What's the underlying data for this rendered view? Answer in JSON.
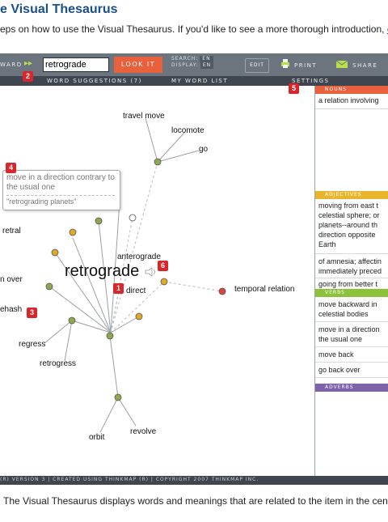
{
  "page": {
    "heading": "e Visual Thesaurus",
    "intro": "eps on how to use the Visual Thesaurus. If you'd like to see a more thorough introduction, ",
    "intro_link": "click",
    "caption": "The Visual Thesaurus displays words and meanings that are related to the item in the center"
  },
  "toolbar": {
    "forward_label": "WARD",
    "search_value": "retrograde",
    "lookup_label": "LOOK IT UP",
    "search_label": "SEARCH:",
    "search_lang": "EN",
    "display_label": "DISPLAY:",
    "display_lang": "EN",
    "edit_label": "EDIT",
    "print_label": "PRINT",
    "share_label": "SHARE"
  },
  "subbar": {
    "word_suggestions": "WORD SUGGESTIONS (7)",
    "word_list": "MY WORD LIST",
    "settings": "SETTINGS"
  },
  "badges": {
    "b1": "1",
    "b2": "2",
    "b3": "3",
    "b4": "4",
    "b5": "5",
    "b6": "6"
  },
  "graph": {
    "center": "retrograde",
    "words": {
      "travel_move": "travel move",
      "locomote": "locomote",
      "go": "go",
      "retral": "retral",
      "anterograde": "anterograde",
      "direct": "direct",
      "temporal_relation": "temporal relation",
      "go_back_over": "n over",
      "rehash": "ehash",
      "regress": "regress",
      "retrogress": "retrogress",
      "orbit": "orbit",
      "revolve": "revolve"
    },
    "tooltip": {
      "definition": "move in a direction contrary to the usual one",
      "example": "\"retrograding planets\""
    },
    "colors": {
      "noun_node": "#d9453a",
      "adj_node": "#e0a92a",
      "verb_node": "#8fa84f",
      "link": "#9aa0a6"
    }
  },
  "panel": {
    "nouns_header": "NOUNS",
    "nouns": [
      "a relation involving"
    ],
    "adjectives_header": "ADJECTIVES",
    "adjectives": [
      "moving from east t celestial sphere; or planets--around th direction opposite Earth",
      "of amnesia; affectin immediately preced",
      "going from better t"
    ],
    "verbs_header": "VERBS",
    "verbs": [
      "move backward in celestial bodies",
      "move in a direction the usual one",
      "move back",
      "go back over"
    ],
    "adverbs_header": "ADVERBS"
  },
  "footer": {
    "text": "(R) VERSION 3 | CREATED USING THINKMAP (R) | COPYRIGHT 2007 THINKMAP INC."
  }
}
